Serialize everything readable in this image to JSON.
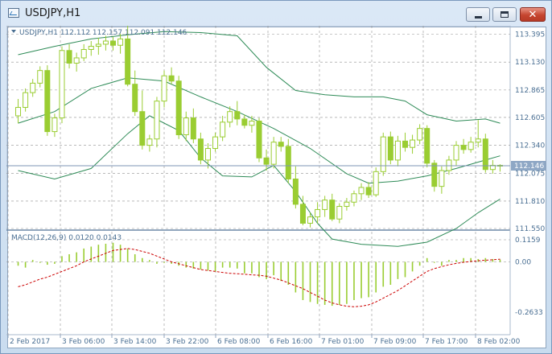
{
  "window": {
    "title": "USDJPY,H1",
    "icon": "chart-window-icon",
    "buttons": {
      "minimize": "minimize-icon",
      "maximize": "maximize-icon",
      "close": "close-icon",
      "close_glyph": "✕"
    }
  },
  "colors": {
    "up_candle": "#9acd32",
    "bands": "#2e8b57",
    "signal": "#cc0000",
    "grid": "#909090",
    "axis_text": "#4a6f93",
    "price_line": "#7c95b5",
    "price_tag_bg": "#8ea7c5"
  },
  "chart_data": {
    "type": "candlestick",
    "symbol": "USDJPY",
    "timeframe": "H1",
    "ohlc_header": "USDJPY,H1  112.112 112.157 112.091 112.146",
    "current_price": "112.146",
    "price_axis_labels": [
      "113.395",
      "113.130",
      "112.865",
      "112.605",
      "112.340",
      "112.075",
      "111.810",
      "111.550"
    ],
    "time_axis_labels": [
      "2 Feb 2017",
      "3 Feb 06:00",
      "3 Feb 14:00",
      "3 Feb 22:00",
      "6 Feb 08:00",
      "6 Feb 16:00",
      "7 Feb 01:00",
      "7 Feb 09:00",
      "7 Feb 17:00",
      "8 Feb 02:00"
    ],
    "ylim": [
      111.55,
      113.46
    ],
    "candles": [
      [
        112.62,
        112.78,
        112.55,
        112.7
      ],
      [
        112.7,
        112.88,
        112.66,
        112.84
      ],
      [
        112.84,
        112.97,
        112.8,
        112.93
      ],
      [
        112.93,
        113.09,
        112.89,
        113.05
      ],
      [
        113.05,
        113.1,
        112.43,
        112.47
      ],
      [
        112.47,
        112.64,
        112.42,
        112.6
      ],
      [
        112.6,
        113.28,
        112.55,
        113.24
      ],
      [
        113.24,
        113.3,
        113.07,
        113.12
      ],
      [
        113.12,
        113.22,
        113.04,
        113.17
      ],
      [
        113.17,
        113.3,
        113.14,
        113.25
      ],
      [
        113.25,
        113.33,
        113.19,
        113.28
      ],
      [
        113.28,
        113.36,
        113.2,
        113.3
      ],
      [
        113.3,
        113.38,
        113.24,
        113.33
      ],
      [
        113.33,
        113.37,
        113.24,
        113.29
      ],
      [
        113.29,
        113.4,
        113.21,
        113.35
      ],
      [
        113.35,
        113.48,
        112.9,
        112.92
      ],
      [
        112.92,
        113.05,
        112.62,
        112.66
      ],
      [
        112.66,
        112.86,
        112.3,
        112.34
      ],
      [
        112.34,
        112.44,
        112.28,
        112.4
      ],
      [
        112.4,
        112.8,
        112.32,
        112.76
      ],
      [
        112.76,
        113.05,
        112.7,
        113.0
      ],
      [
        113.0,
        113.08,
        112.92,
        112.95
      ],
      [
        112.95,
        113.0,
        112.4,
        112.44
      ],
      [
        112.44,
        112.66,
        112.38,
        112.6
      ],
      [
        112.6,
        112.69,
        112.36,
        112.4
      ],
      [
        112.4,
        112.46,
        112.16,
        112.2
      ],
      [
        112.2,
        112.36,
        112.12,
        112.31
      ],
      [
        112.31,
        112.46,
        112.28,
        112.42
      ],
      [
        112.42,
        112.62,
        112.38,
        112.56
      ],
      [
        112.56,
        112.71,
        112.51,
        112.66
      ],
      [
        112.66,
        112.76,
        112.53,
        112.59
      ],
      [
        112.59,
        112.63,
        112.5,
        112.53
      ],
      [
        112.53,
        112.62,
        112.46,
        112.57
      ],
      [
        112.57,
        112.6,
        112.18,
        112.22
      ],
      [
        112.22,
        112.3,
        112.1,
        112.16
      ],
      [
        112.16,
        112.42,
        112.12,
        112.37
      ],
      [
        112.37,
        112.42,
        112.28,
        112.33
      ],
      [
        112.33,
        112.4,
        111.98,
        112.02
      ],
      [
        112.02,
        112.14,
        111.74,
        111.78
      ],
      [
        111.78,
        111.86,
        111.58,
        111.6
      ],
      [
        111.6,
        111.7,
        111.56,
        111.66
      ],
      [
        111.66,
        111.8,
        111.6,
        111.73
      ],
      [
        111.73,
        111.86,
        111.66,
        111.82
      ],
      [
        111.82,
        111.88,
        111.62,
        111.64
      ],
      [
        111.64,
        111.79,
        111.6,
        111.76
      ],
      [
        111.76,
        111.84,
        111.72,
        111.8
      ],
      [
        111.8,
        111.91,
        111.76,
        111.88
      ],
      [
        111.88,
        111.98,
        111.82,
        111.94
      ],
      [
        111.94,
        111.99,
        111.84,
        111.87
      ],
      [
        111.87,
        112.13,
        111.85,
        112.09
      ],
      [
        112.09,
        112.46,
        112.05,
        112.42
      ],
      [
        112.42,
        112.47,
        112.16,
        112.2
      ],
      [
        112.2,
        112.43,
        112.14,
        112.38
      ],
      [
        112.38,
        112.46,
        112.28,
        112.32
      ],
      [
        112.32,
        112.44,
        112.26,
        112.39
      ],
      [
        112.39,
        112.54,
        112.35,
        112.5
      ],
      [
        112.5,
        112.53,
        112.13,
        112.17
      ],
      [
        112.17,
        112.2,
        111.9,
        111.95
      ],
      [
        111.95,
        112.14,
        111.88,
        112.1
      ],
      [
        112.1,
        112.24,
        112.06,
        112.2
      ],
      [
        112.2,
        112.38,
        112.15,
        112.34
      ],
      [
        112.34,
        112.4,
        112.26,
        112.3
      ],
      [
        112.3,
        112.42,
        112.27,
        112.37
      ],
      [
        112.37,
        112.58,
        112.32,
        112.4
      ],
      [
        112.4,
        112.45,
        112.08,
        112.11
      ],
      [
        112.11,
        112.2,
        112.07,
        112.15
      ],
      [
        112.15,
        112.16,
        112.09,
        112.146
      ]
    ],
    "bollinger": {
      "upper": [
        [
          0,
          113.2
        ],
        [
          5,
          113.28
        ],
        [
          10,
          113.35
        ],
        [
          15,
          113.39
        ],
        [
          20,
          113.42
        ],
        [
          25,
          113.41
        ],
        [
          30,
          113.38
        ],
        [
          34,
          113.08
        ],
        [
          38,
          112.86
        ],
        [
          42,
          112.82
        ],
        [
          46,
          112.8
        ],
        [
          50,
          112.8
        ],
        [
          53,
          112.76
        ],
        [
          56,
          112.63
        ],
        [
          60,
          112.57
        ],
        [
          64,
          112.59
        ],
        [
          66,
          112.55
        ]
      ],
      "middle": [
        [
          0,
          112.55
        ],
        [
          5,
          112.66
        ],
        [
          10,
          112.88
        ],
        [
          15,
          112.98
        ],
        [
          20,
          112.95
        ],
        [
          25,
          112.8
        ],
        [
          30,
          112.66
        ],
        [
          35,
          112.5
        ],
        [
          40,
          112.31
        ],
        [
          45,
          112.07
        ],
        [
          48,
          111.98
        ],
        [
          52,
          112.0
        ],
        [
          56,
          112.05
        ],
        [
          60,
          112.12
        ],
        [
          64,
          112.2
        ],
        [
          66,
          112.24
        ]
      ],
      "lower": [
        [
          0,
          112.1
        ],
        [
          5,
          112.02
        ],
        [
          10,
          112.12
        ],
        [
          15,
          112.45
        ],
        [
          18,
          112.62
        ],
        [
          22,
          112.48
        ],
        [
          25,
          112.22
        ],
        [
          28,
          112.05
        ],
        [
          32,
          112.04
        ],
        [
          35,
          112.15
        ],
        [
          38,
          111.9
        ],
        [
          41,
          111.6
        ],
        [
          43,
          111.45
        ],
        [
          47,
          111.4
        ],
        [
          52,
          111.38
        ],
        [
          56,
          111.42
        ],
        [
          60,
          111.55
        ],
        [
          63,
          111.7
        ],
        [
          66,
          111.83
        ]
      ]
    },
    "macd": {
      "label": "MACD(12,26,9) 0.0120 0.0143",
      "axis_labels": [
        "0.1159",
        "0.00",
        "-0.2633"
      ],
      "ylim": [
        -0.2633,
        0.1159
      ],
      "histogram": [
        -0.02,
        -0.03,
        0.01,
        -0.005,
        -0.015,
        -0.01,
        0.03,
        0.04,
        0.05,
        0.07,
        0.08,
        0.09,
        0.095,
        0.1,
        0.09,
        0.07,
        0.04,
        0.02,
        0.01,
        -0.01,
        -0.005,
        -0.01,
        -0.02,
        -0.03,
        -0.035,
        -0.04,
        -0.045,
        -0.05,
        -0.03,
        -0.03,
        -0.035,
        -0.06,
        -0.06,
        -0.08,
        -0.09,
        -0.07,
        -0.1,
        -0.12,
        -0.16,
        -0.2,
        -0.21,
        -0.22,
        -0.225,
        -0.23,
        -0.225,
        -0.22,
        -0.2,
        -0.19,
        -0.185,
        -0.16,
        -0.13,
        -0.12,
        -0.09,
        -0.08,
        -0.05,
        -0.02,
        0.02,
        -0.005,
        -0.02,
        0.01,
        0.01,
        0.02,
        0.02,
        0.015,
        0.02,
        0.015,
        0.012
      ],
      "signal": [
        -0.13,
        -0.12,
        -0.105,
        -0.09,
        -0.08,
        -0.065,
        -0.05,
        -0.035,
        -0.02,
        0.0,
        0.015,
        0.03,
        0.045,
        0.06,
        0.065,
        0.07,
        0.065,
        0.055,
        0.045,
        0.03,
        0.015,
        0.0,
        -0.01,
        -0.02,
        -0.03,
        -0.04,
        -0.045,
        -0.05,
        -0.055,
        -0.06,
        -0.062,
        -0.065,
        -0.068,
        -0.07,
        -0.075,
        -0.085,
        -0.095,
        -0.11,
        -0.125,
        -0.14,
        -0.16,
        -0.18,
        -0.2,
        -0.215,
        -0.225,
        -0.232,
        -0.235,
        -0.232,
        -0.225,
        -0.21,
        -0.19,
        -0.17,
        -0.15,
        -0.125,
        -0.1,
        -0.075,
        -0.05,
        -0.035,
        -0.025,
        -0.015,
        -0.008,
        -0.002,
        0.002,
        0.006,
        0.009,
        0.011,
        0.0143
      ]
    }
  }
}
